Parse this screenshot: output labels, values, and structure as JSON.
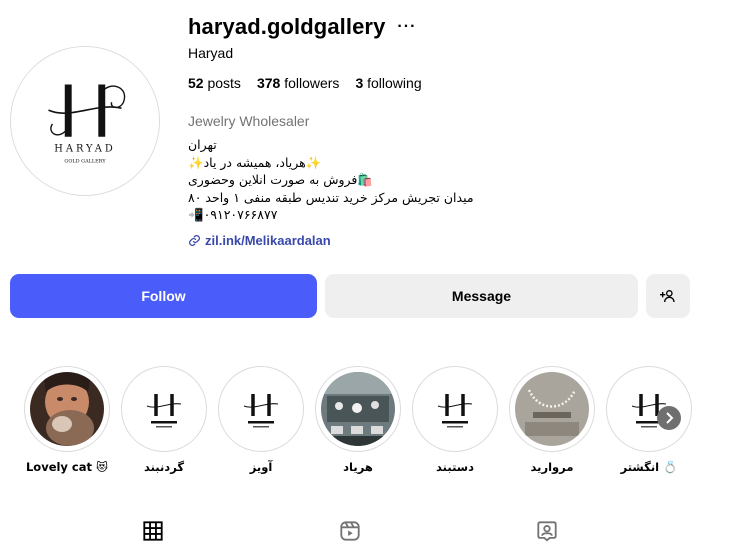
{
  "profile": {
    "username": "haryad.goldgallery",
    "full_name": "Haryad",
    "logo_brand": "HARYAD",
    "logo_sub": "GOLD GALLERY",
    "stats": {
      "posts_count": "52",
      "posts_label": "posts",
      "followers_count": "378",
      "followers_label": "followers",
      "following_count": "3",
      "following_label": "following"
    },
    "category": "Jewelry Wholesaler",
    "bio": [
      "تهران",
      "✨هریاد، همیشه در یاد✨",
      "🛍️فروش به صورت انلاین وحضوری",
      "میدان تجریش مرکز خرید تندیس طبقه منفی ۱ واحد ۸۰",
      "📲۰۹۱۲۰۷۶۶۸۷۷"
    ],
    "link": "zil.ink/Melikaardalan"
  },
  "buttons": {
    "follow": "Follow",
    "message": "Message"
  },
  "highlights": [
    {
      "label": "Lovely cat 😻",
      "thumb": "photo-cat"
    },
    {
      "label": "گردنبند",
      "thumb": "logo"
    },
    {
      "label": "آویز",
      "thumb": "logo"
    },
    {
      "label": "هریاد",
      "thumb": "photo-store"
    },
    {
      "label": "دستبند",
      "thumb": "logo"
    },
    {
      "label": "مروارید",
      "thumb": "photo-necklace"
    },
    {
      "label": "انگشتر 💍",
      "thumb": "logo"
    }
  ],
  "icons": {
    "more": "more-dots-icon",
    "link": "link-icon",
    "add_user": "add-user-icon",
    "next": "chevron-right-icon",
    "tabs": [
      "grid-icon",
      "reels-icon",
      "tagged-icon"
    ]
  },
  "colors": {
    "accent": "#4a5dfb",
    "link": "#3949ab",
    "secondary_button": "#efefef",
    "muted_text": "#737373"
  }
}
